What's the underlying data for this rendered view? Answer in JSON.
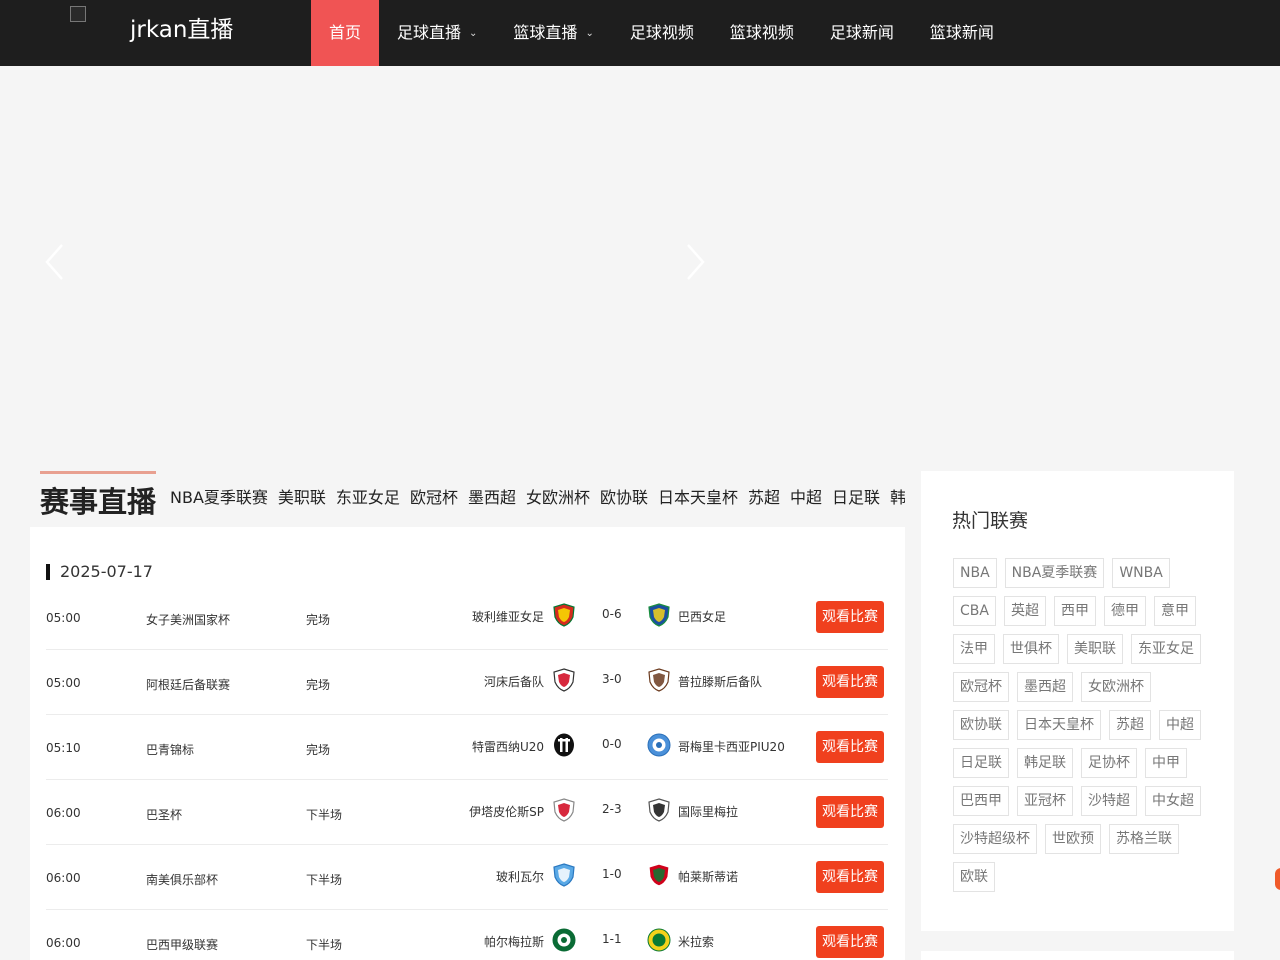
{
  "header": {
    "logo_text": "jrkan直播",
    "nav": [
      {
        "label": "首页",
        "active": true,
        "dropdown": false
      },
      {
        "label": "足球直播",
        "active": false,
        "dropdown": true
      },
      {
        "label": "篮球直播",
        "active": false,
        "dropdown": true
      },
      {
        "label": "足球视频",
        "active": false,
        "dropdown": false
      },
      {
        "label": "篮球视频",
        "active": false,
        "dropdown": false
      },
      {
        "label": "足球新闻",
        "active": false,
        "dropdown": false
      },
      {
        "label": "篮球新闻",
        "active": false,
        "dropdown": false
      }
    ]
  },
  "live": {
    "title": "赛事直播",
    "league_tabs": [
      "NBA夏季联赛",
      "美职联",
      "东亚女足",
      "欧冠杯",
      "墨西超",
      "女欧洲杯",
      "欧协联",
      "日本天皇杯",
      "苏超",
      "中超",
      "日足联",
      "韩"
    ],
    "date": "2025-07-17",
    "watch_label": "观看比赛",
    "matches": [
      {
        "time": "05:00",
        "league": "女子美洲国家杯",
        "status": "完场",
        "home": "玻利维亚女足",
        "score": "0-6",
        "away": "巴西女足",
        "home_logo": "bolivia-crest-icon",
        "away_logo": "brazil-crest-icon"
      },
      {
        "time": "05:00",
        "league": "阿根廷后备联赛",
        "status": "完场",
        "home": "河床后备队",
        "score": "3-0",
        "away": "普拉滕斯后备队",
        "home_logo": "river-plate-crest-icon",
        "away_logo": "platense-crest-icon"
      },
      {
        "time": "05:10",
        "league": "巴青锦标",
        "status": "完场",
        "home": "特雷西纳U20",
        "score": "0-0",
        "away": "哥梅里卡西亚PIU20",
        "home_logo": "teresina-crest-icon",
        "away_logo": "piaui-crest-icon"
      },
      {
        "time": "06:00",
        "league": "巴圣杯",
        "status": "下半场",
        "home": "伊塔皮伦斯SP",
        "score": "2-3",
        "away": "国际里梅拉",
        "home_logo": "itapirense-crest-icon",
        "away_logo": "inter-limeira-crest-icon"
      },
      {
        "time": "06:00",
        "league": "南美俱乐部杯",
        "status": "下半场",
        "home": "玻利瓦尔",
        "score": "1-0",
        "away": "帕莱斯蒂诺",
        "home_logo": "bolivar-crest-icon",
        "away_logo": "palestino-crest-icon"
      },
      {
        "time": "06:00",
        "league": "巴西甲级联赛",
        "status": "下半场",
        "home": "帕尔梅拉斯",
        "score": "1-1",
        "away": "米拉索",
        "home_logo": "palmeiras-crest-icon",
        "away_logo": "mirassol-crest-icon"
      }
    ]
  },
  "hot": {
    "title": "热门联赛",
    "tags": [
      "NBA",
      "NBA夏季联赛",
      "WNBA",
      "CBA",
      "英超",
      "西甲",
      "德甲",
      "意甲",
      "法甲",
      "世俱杯",
      "美职联",
      "东亚女足",
      "欧冠杯",
      "墨西超",
      "女欧洲杯",
      "欧协联",
      "日本天皇杯",
      "苏超",
      "中超",
      "日足联",
      "韩足联",
      "足协杯",
      "中甲",
      "巴西甲",
      "亚冠杯",
      "沙特超",
      "中女超",
      "沙特超级杯",
      "世欧预",
      "苏格兰联",
      "欧联"
    ]
  },
  "colors": {
    "header_bg": "#1e1e1e",
    "nav_active": "#f05454",
    "watch_button": "#f0401e"
  }
}
